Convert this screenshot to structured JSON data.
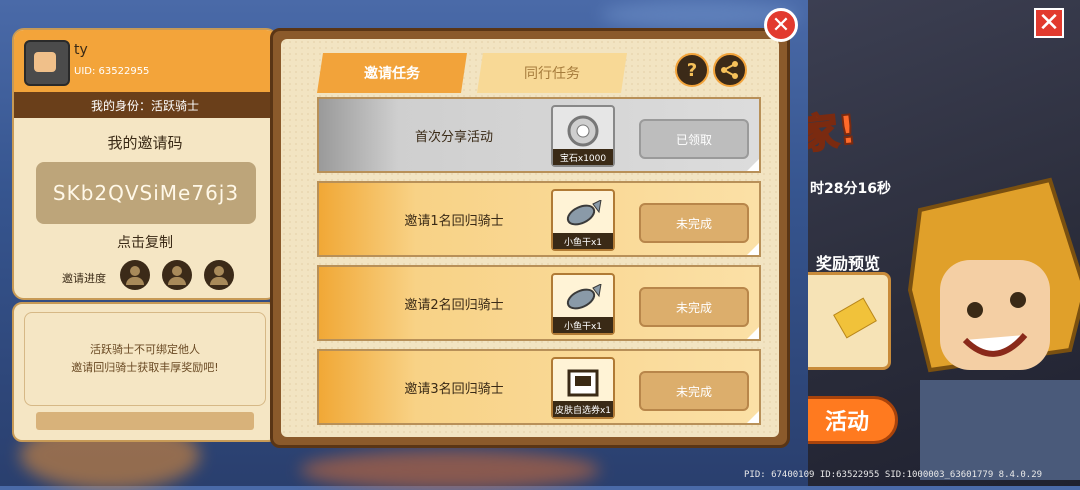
{
  "profile": {
    "username": "ty",
    "uid_text": "UID:  63522955",
    "identity_text": "我的身份：活跃骑士",
    "code_title": "我的邀请码",
    "invite_code": "SKb2QVSiMe76j3",
    "copy_label": "点击复制",
    "progress_label": "邀请进度",
    "progress_filled": 0,
    "progress_total": 3
  },
  "note": {
    "line1": "活跃骑士不可绑定他人",
    "line2": "邀请回归骑士获取丰厚奖励吧!"
  },
  "tabs": {
    "invite": "邀请任务",
    "together": "同行任务"
  },
  "buttons": {
    "help": "?",
    "share_icon": "share-icon"
  },
  "tasks": [
    {
      "name": "首次分享活动",
      "reward_label": "宝石x1000",
      "reward_icon": "gem-icon",
      "status": "已领取"
    },
    {
      "name": "邀请1名回归骑士",
      "reward_label": "小鱼干x1",
      "reward_icon": "fish-icon",
      "status": "未完成"
    },
    {
      "name": "邀请2名回归骑士",
      "reward_label": "小鱼干x1",
      "reward_icon": "fish-icon",
      "status": "未完成"
    },
    {
      "name": "邀请3名回归骑士",
      "reward_label": "皮肤自选券x1",
      "reward_icon": "skin-ticket-icon",
      "status": "未完成"
    }
  ],
  "right_art": {
    "banner": "家!",
    "timer": "时28分16秒",
    "reward_preview": "奖励预览",
    "activity_button": "活动"
  },
  "footer": {
    "pid": "PID: 67400109",
    "ids": "ID:63522955 SID:1000003_63601779 8.4.0.29"
  },
  "colors": {
    "accent_orange": "#f2a33a",
    "close_red": "#e23a2e",
    "panel_brown": "#8b5a2b"
  }
}
